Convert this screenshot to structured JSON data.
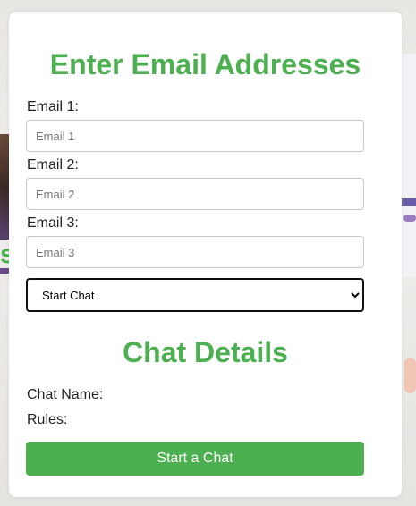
{
  "form": {
    "title": "Enter Email Addresses",
    "emails": [
      {
        "label": "Email 1:",
        "placeholder": "Email 1",
        "value": ""
      },
      {
        "label": "Email 2:",
        "placeholder": "Email 2",
        "value": ""
      },
      {
        "label": "Email 3:",
        "placeholder": "Email 3",
        "value": ""
      }
    ],
    "select": {
      "selected": "Start Chat",
      "options": [
        "Start Chat"
      ]
    }
  },
  "details": {
    "title": "Chat Details",
    "chat_name_label": "Chat Name:",
    "rules_label": "Rules:"
  },
  "actions": {
    "start_label": "Start a Chat"
  },
  "background": {
    "partial_text": "s"
  },
  "colors": {
    "accent": "#4caf50",
    "card": "#ffffff"
  }
}
